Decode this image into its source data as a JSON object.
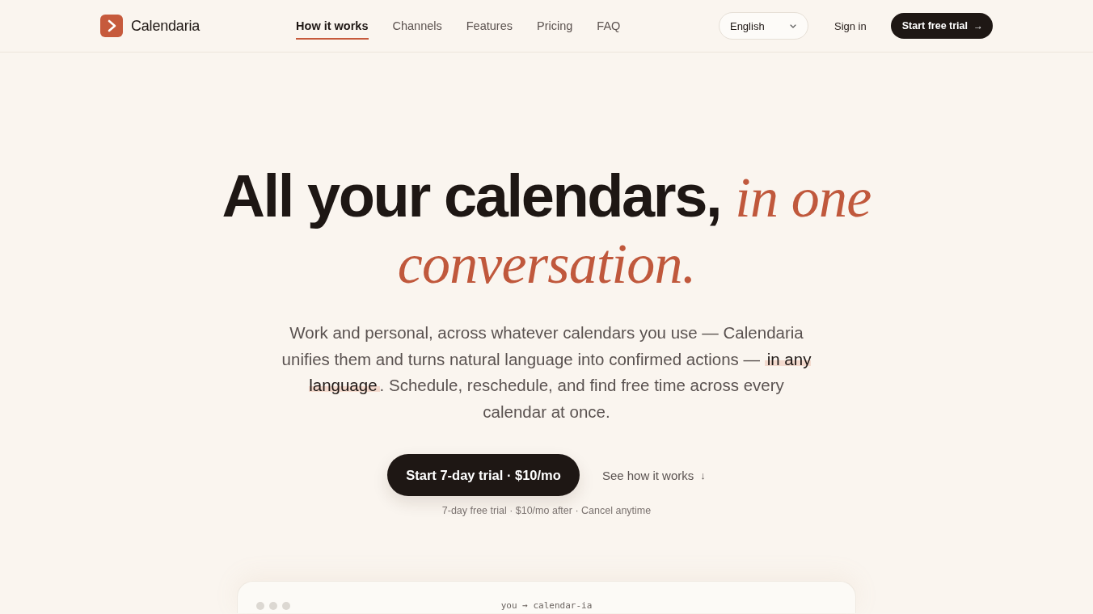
{
  "brand": {
    "name": "Calendaria"
  },
  "nav": [
    {
      "label": "How it works",
      "selected": true
    },
    {
      "label": "Channels",
      "selected": false
    },
    {
      "label": "Features",
      "selected": false
    },
    {
      "label": "Pricing",
      "selected": false
    },
    {
      "label": "FAQ",
      "selected": false
    }
  ],
  "language_select": {
    "value": "English"
  },
  "sign_in": "Sign in",
  "header_cta": {
    "label": "Start free trial",
    "arrow": "→"
  },
  "hero": {
    "headline": "All your calendars, *in one conversation.*",
    "subtitle": [
      {
        "text": "Work and personal, across whatever calendars you use — Calendaria unifies them and turns natural language into confirmed actions — ",
        "highlight": false
      },
      {
        "text": "in any language",
        "highlight": true
      },
      {
        "text": ". Schedule, reschedule, and find free time across every calendar at once.",
        "highlight": false
      }
    ],
    "primary_cta": "Start 7-day trial · $10/mo",
    "secondary_cta": {
      "label": "See how it works",
      "arrow": "↓"
    },
    "fine_print": "7-day free trial · $10/mo after · Cancel anytime"
  },
  "chat_window": {
    "title": "you → calendar-ia"
  }
}
